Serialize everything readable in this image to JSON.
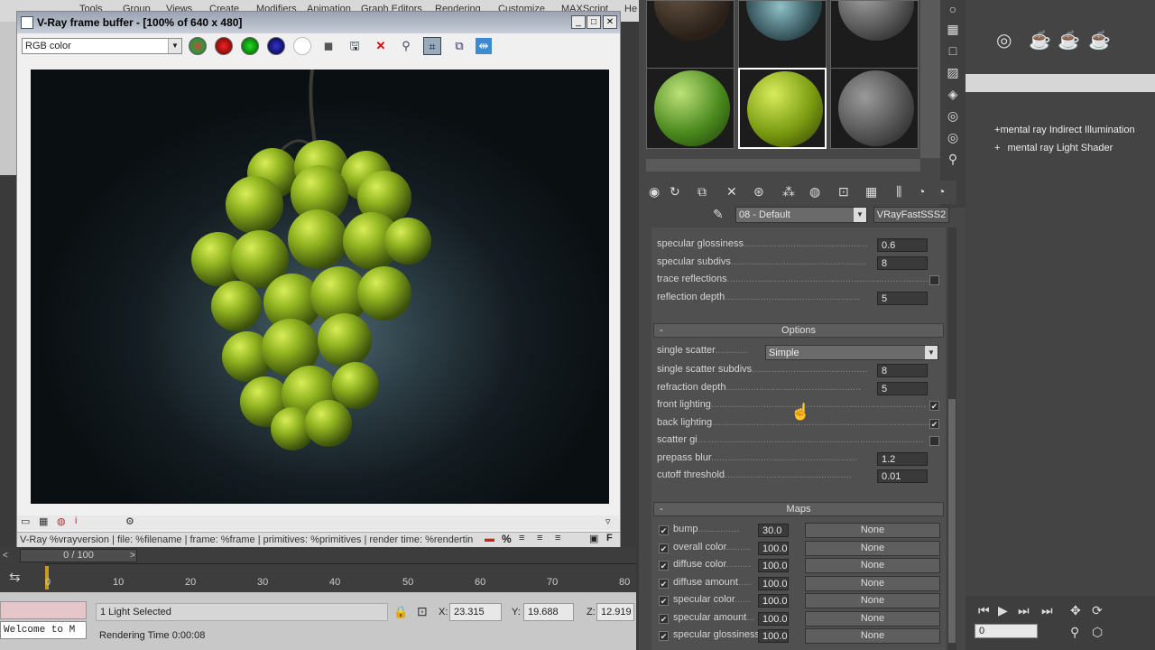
{
  "app_menu": [
    "Tools",
    "Group",
    "Views",
    "Create",
    "Modifiers",
    "Animation",
    "Graph Editors",
    "Rendering",
    "Customize",
    "MAXScript",
    "He"
  ],
  "vfb": {
    "title": "V-Ray frame buffer - [100% of 640 x 480]",
    "channel": "RGB color",
    "status": "V-Ray %vrayversion | file: %filename | frame: %frame | primitives: %primitives | render time: %rendertin"
  },
  "timeline": {
    "slider": "0 / 100",
    "ticks": [
      "0",
      "10",
      "20",
      "30",
      "40",
      "50",
      "60",
      "70",
      "80"
    ]
  },
  "statusbar": {
    "maxscript": "",
    "welcome": "Welcome to M",
    "selection": "1 Light Selected",
    "render_time": "Rendering Time  0:00:08",
    "x_label": "X:",
    "x": "23.315",
    "y_label": "Y:",
    "y": "19.688",
    "z_label": "Z:",
    "z": "12.919"
  },
  "material_editor": {
    "material_name": "08 - Default",
    "material_type": "VRayFastSSS2",
    "reflection_params": [
      {
        "label": "specular glossiness",
        "value": "0.6"
      },
      {
        "label": "specular subdivs",
        "value": "8"
      },
      {
        "label": "trace reflections",
        "checked": false
      },
      {
        "label": "reflection depth",
        "value": "5"
      }
    ],
    "options_title": "Options",
    "options": {
      "single_scatter_label": "single scatter",
      "single_scatter_value": "Simple",
      "single_scatter_subdivs_label": "single scatter subdivs",
      "single_scatter_subdivs": "8",
      "refraction_depth_label": "refraction depth",
      "refraction_depth": "5",
      "front_lighting_label": "front lighting",
      "front_lighting": true,
      "back_lighting_label": "back lighting",
      "back_lighting": true,
      "scatter_gi_label": "scatter gi",
      "scatter_gi": false,
      "prepass_blur_label": "prepass blur",
      "prepass_blur": "1.2",
      "cutoff_threshold_label": "cutoff threshold",
      "cutoff_threshold": "0.01"
    },
    "maps_title": "Maps",
    "maps": [
      {
        "label": "bump",
        "value": "30.0",
        "map": "None"
      },
      {
        "label": "overall color",
        "value": "100.0",
        "map": "None"
      },
      {
        "label": "diffuse color",
        "value": "100.0",
        "map": "None"
      },
      {
        "label": "diffuse amount",
        "value": "100.0",
        "map": "None"
      },
      {
        "label": "specular color",
        "value": "100.0",
        "map": "None"
      },
      {
        "label": "specular amount",
        "value": "100.0",
        "map": "None"
      },
      {
        "label": "specular glossiness",
        "value": "100.0",
        "map": "None"
      }
    ]
  },
  "right_panel": {
    "tree": [
      {
        "sign": "+",
        "label": "mental ray Indirect Illumination"
      },
      {
        "sign": "+",
        "label": "mental ray Light Shader"
      }
    ],
    "frame": "0"
  }
}
